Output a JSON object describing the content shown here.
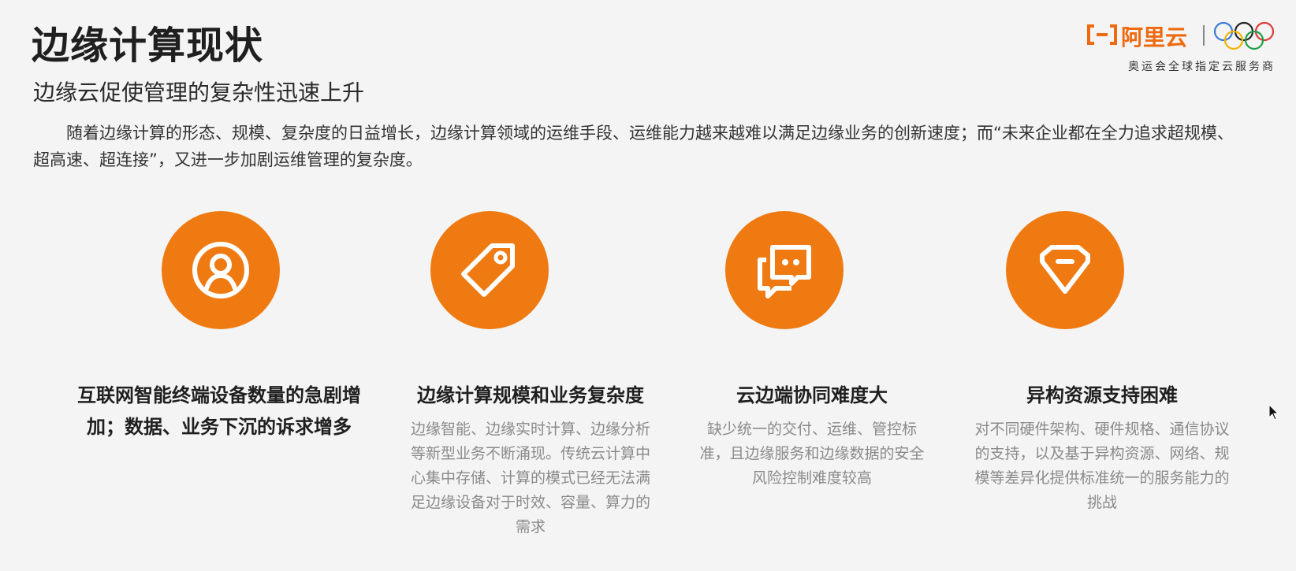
{
  "slide": {
    "title": "边缘计算现状",
    "subtitle": "边缘云促使管理的复杂性迅速上升",
    "intro": "随着边缘计算的形态、规模、复杂度的日益增长，边缘计算领域的运维手段、运维能力越来越难以满足边缘业务的创新速度；而“未来企业都在全力追求超规模、超高速、超连接”，又进一步加剧运维管理的复杂度。"
  },
  "logo": {
    "name": "阿里云",
    "tagline": "奥运会全球指定云服务商",
    "brand_color": "#ee6a0e"
  },
  "accent_color": "#ef7a12",
  "cards": [
    {
      "icon": "user-icon",
      "title": "互联网智能终端设备数量的急剧增加；数据、业务下沉的诉求增多",
      "desc": ""
    },
    {
      "icon": "tag-icon",
      "title": "边缘计算规模和业务复杂度",
      "desc": "边缘智能、边缘实时计算、边缘分析等新型业务不断涌现。传统云计算中心集中存储、计算的模式已经无法满足边缘设备对于时效、容量、算力的需求"
    },
    {
      "icon": "chat-icon",
      "title": "云边端协同难度大",
      "desc": "缺少统一的交付、运维、管控标准，且边缘服务和边缘数据的安全风险控制难度较高"
    },
    {
      "icon": "gem-icon",
      "title": "异构资源支持困难",
      "desc": "对不同硬件架构、硬件规格、通信协议的支持，以及基于异构资源、网络、规模等差异化提供标准统一的服务能力的挑战"
    }
  ]
}
